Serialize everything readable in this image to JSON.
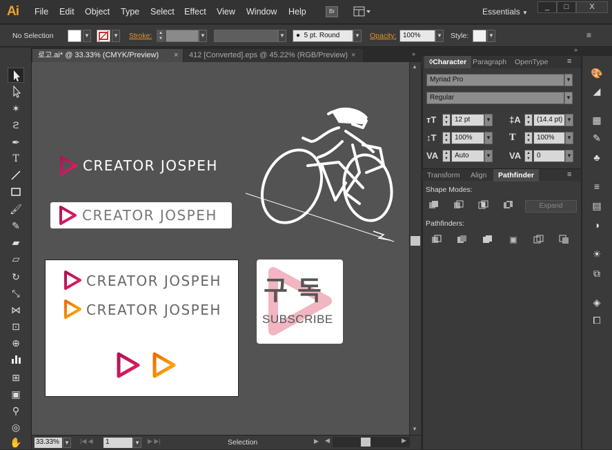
{
  "app": {
    "logo": "Ai"
  },
  "menubar": {
    "items": [
      "File",
      "Edit",
      "Object",
      "Type",
      "Select",
      "Effect",
      "View",
      "Window",
      "Help"
    ],
    "bridge_label": "Br",
    "workspace": "Essentials",
    "window_buttons": [
      "_",
      "□",
      "X"
    ]
  },
  "control_bar": {
    "selection": "No Selection",
    "stroke_label": "Stroke:",
    "brush": "5 pt. Round",
    "opacity_label": "Opacity:",
    "opacity_value": "100%",
    "style_label": "Style:"
  },
  "tabs": [
    {
      "label": "로고.ai* @ 33.33% (CMYK/Preview)",
      "active": true
    },
    {
      "label": "412 [Converted].eps @ 45.22% (RGB/Preview)",
      "active": false
    }
  ],
  "artwork": {
    "wordmark": "CREATOR JOSPEH",
    "korean_a": "구",
    "korean_b": "독",
    "subscribe": "SUBSCRIBE"
  },
  "character_panel": {
    "tabs": [
      "Character",
      "Paragraph",
      "OpenType"
    ],
    "font_family": "Myriad Pro",
    "font_style": "Regular",
    "font_size": "12 pt",
    "leading": "(14.4 pt)",
    "vert_scale": "100%",
    "horiz_scale": "100%",
    "kerning": "Auto",
    "tracking": "0"
  },
  "pathfinder_panel": {
    "tabs": [
      "Transform",
      "Align",
      "Pathfinder"
    ],
    "shape_modes_label": "Shape Modes:",
    "expand_label": "Expand",
    "pathfinders_label": "Pathfinders:"
  },
  "status_bar": {
    "zoom": "33.33%",
    "artboard": "1",
    "tool": "Selection"
  },
  "colors": {
    "accent": "#f0a030",
    "pink": "#c2185b",
    "orange": "#f39c25"
  }
}
